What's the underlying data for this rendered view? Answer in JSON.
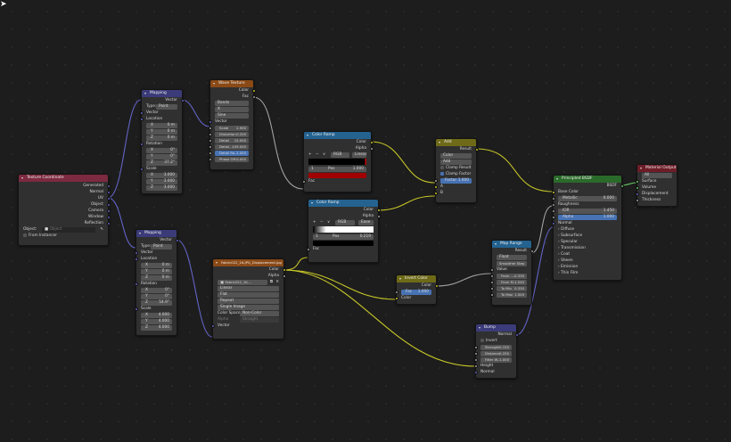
{
  "colors": {
    "hdr_input": "#7d2a40",
    "hdr_vector": "#3b3b7a",
    "hdr_texture": "#8a4a16",
    "hdr_converter": "#246290",
    "hdr_color": "#6e6a18",
    "hdr_shader": "#2a6a2a",
    "hdr_output": "#6e1d28",
    "wire_vec": "#6363c7",
    "wire_col": "#c7c729",
    "wire_gry": "#a1a1a1",
    "wire_grn": "#63c763"
  },
  "texcoord": {
    "title": "Texture Coordinate",
    "outputs": [
      "Generated",
      "Normal",
      "UV",
      "Object",
      "Camera",
      "Window",
      "Reflection"
    ],
    "object_label": "Object:",
    "object_placeholder": "Object",
    "from_instancer": "From Instancer"
  },
  "mapping1": {
    "title": "Mapping",
    "out": "Vector",
    "type_label": "Type:",
    "type_value": "Point",
    "vector": "Vector",
    "location": "Location",
    "rotation": "Rotation",
    "scale": "Scale",
    "loc": [
      {
        "a": "X",
        "v": "0 m"
      },
      {
        "a": "Y",
        "v": "0 m"
      },
      {
        "a": "Z",
        "v": "0 m"
      }
    ],
    "rot": [
      {
        "a": "X",
        "v": "0°"
      },
      {
        "a": "Y",
        "v": "0°"
      },
      {
        "a": "Z",
        "v": "37.2°"
      }
    ],
    "scl": [
      {
        "a": "X",
        "v": "3.000"
      },
      {
        "a": "Y",
        "v": "3.000"
      },
      {
        "a": "Z",
        "v": "3.000"
      }
    ]
  },
  "mapping2": {
    "title": "Mapping",
    "out": "Vector",
    "type_label": "Type:",
    "type_value": "Point",
    "vector": "Vector",
    "location": "Location",
    "rotation": "Rotation",
    "scale": "Scale",
    "loc": [
      {
        "a": "X",
        "v": "0 m"
      },
      {
        "a": "Y",
        "v": "0 m"
      },
      {
        "a": "Z",
        "v": "0 m"
      }
    ],
    "rot": [
      {
        "a": "X",
        "v": "0°"
      },
      {
        "a": "Y",
        "v": "0°"
      },
      {
        "a": "Z",
        "v": "54.9°"
      }
    ],
    "scl": [
      {
        "a": "X",
        "v": "4.000"
      },
      {
        "a": "Y",
        "v": "4.000"
      },
      {
        "a": "Z",
        "v": "4.000"
      }
    ]
  },
  "wave": {
    "title": "Wave Texture",
    "out_color": "Color",
    "out_fac": "Fac",
    "d1": "Bands",
    "d2": "X",
    "d3": "Sine",
    "vector": "Vector",
    "fields": [
      {
        "l": "Scale",
        "v": "2.900"
      },
      {
        "l": "Distortion",
        "v": "0.200"
      },
      {
        "l": "Detail",
        "v": "15.000"
      },
      {
        "l": "Detail...",
        "v": "109.000"
      },
      {
        "l": "Detail Ro...",
        "v": "1.000"
      },
      {
        "l": "Phase Off...",
        "v": "0.000"
      }
    ]
  },
  "ramp1": {
    "title": "Color Ramp",
    "out_color": "Color",
    "out_alpha": "Alpha",
    "plus": "+",
    "minus": "−",
    "menu": "∨",
    "mode": "RGB",
    "interp": "Linear",
    "index": "1",
    "pos_label": "Pos",
    "pos_value": "1.000",
    "fac": "Fac"
  },
  "ramp2": {
    "title": "Color Ramp",
    "out_color": "Color",
    "out_alpha": "Alpha",
    "plus": "+",
    "minus": "−",
    "menu": "∨",
    "mode": "RGB",
    "interp": "Ease",
    "index": "1",
    "pos_label": "Pos",
    "pos_value": "0.219",
    "fac": "Fac"
  },
  "add": {
    "title": "Add",
    "out": "Result",
    "d1": "Color",
    "d2": "Add",
    "clamp_result": "Clamp Result",
    "clamp_factor": "Clamp Factor",
    "factor_label": "Factor",
    "factor_value": "1.000",
    "in_a": "A",
    "in_b": "B"
  },
  "image": {
    "title": "Fabric022_1K-JPG_Displacement.jpg",
    "out_color": "Color",
    "out_alpha": "Alpha",
    "file": "Fabric022_1K-...",
    "d1": "Linear",
    "d2": "Flat",
    "d3": "Repeat",
    "d4": "Single Image",
    "cs_label": "Color Space",
    "cs_value": "Non-Color",
    "alpha_label": "Alpha",
    "alpha_value": "Straight",
    "vector": "Vector"
  },
  "invert": {
    "title": "Invert Color",
    "out": "Color",
    "fac_label": "Fac",
    "fac_value": "1.000",
    "color": "Color"
  },
  "maprange": {
    "title": "Map Range",
    "out": "Result",
    "d1": "Float",
    "d2": "Smoother Step",
    "value": "Value",
    "fields": [
      {
        "l": "From ...",
        "v": "-0.330"
      },
      {
        "l": "From M...",
        "v": "1.040"
      },
      {
        "l": "To Min",
        "v": "0.330"
      },
      {
        "l": "To Max",
        "v": "1.000"
      }
    ]
  },
  "bump": {
    "title": "Bump",
    "out": "Normal",
    "invert": "Invert",
    "fields": [
      {
        "l": "Strength",
        "v": "0.150"
      },
      {
        "l": "Distance",
        "v": "0.250"
      },
      {
        "l": "Filter W...",
        "v": "1.000"
      }
    ],
    "height": "Height",
    "normal": "Normal"
  },
  "bsdf": {
    "title": "Principled BSDF",
    "out": "BSDF",
    "base_color": "Base Color",
    "metallic_label": "Metallic",
    "metallic_value": "0.000",
    "roughness": "Roughness",
    "ior_label": "IOR",
    "ior_value": "1.450",
    "alpha_label": "Alpha",
    "alpha_value": "1.000",
    "normal": "Normal",
    "panels": [
      "Diffuse",
      "Subsurface",
      "Specular",
      "Transmission",
      "Coat",
      "Sheen",
      "Emission",
      "Thin Film"
    ]
  },
  "output": {
    "title": "Material Output",
    "target": "All",
    "inputs": [
      "Surface",
      "Volume",
      "Displacement",
      "Thickness"
    ]
  }
}
